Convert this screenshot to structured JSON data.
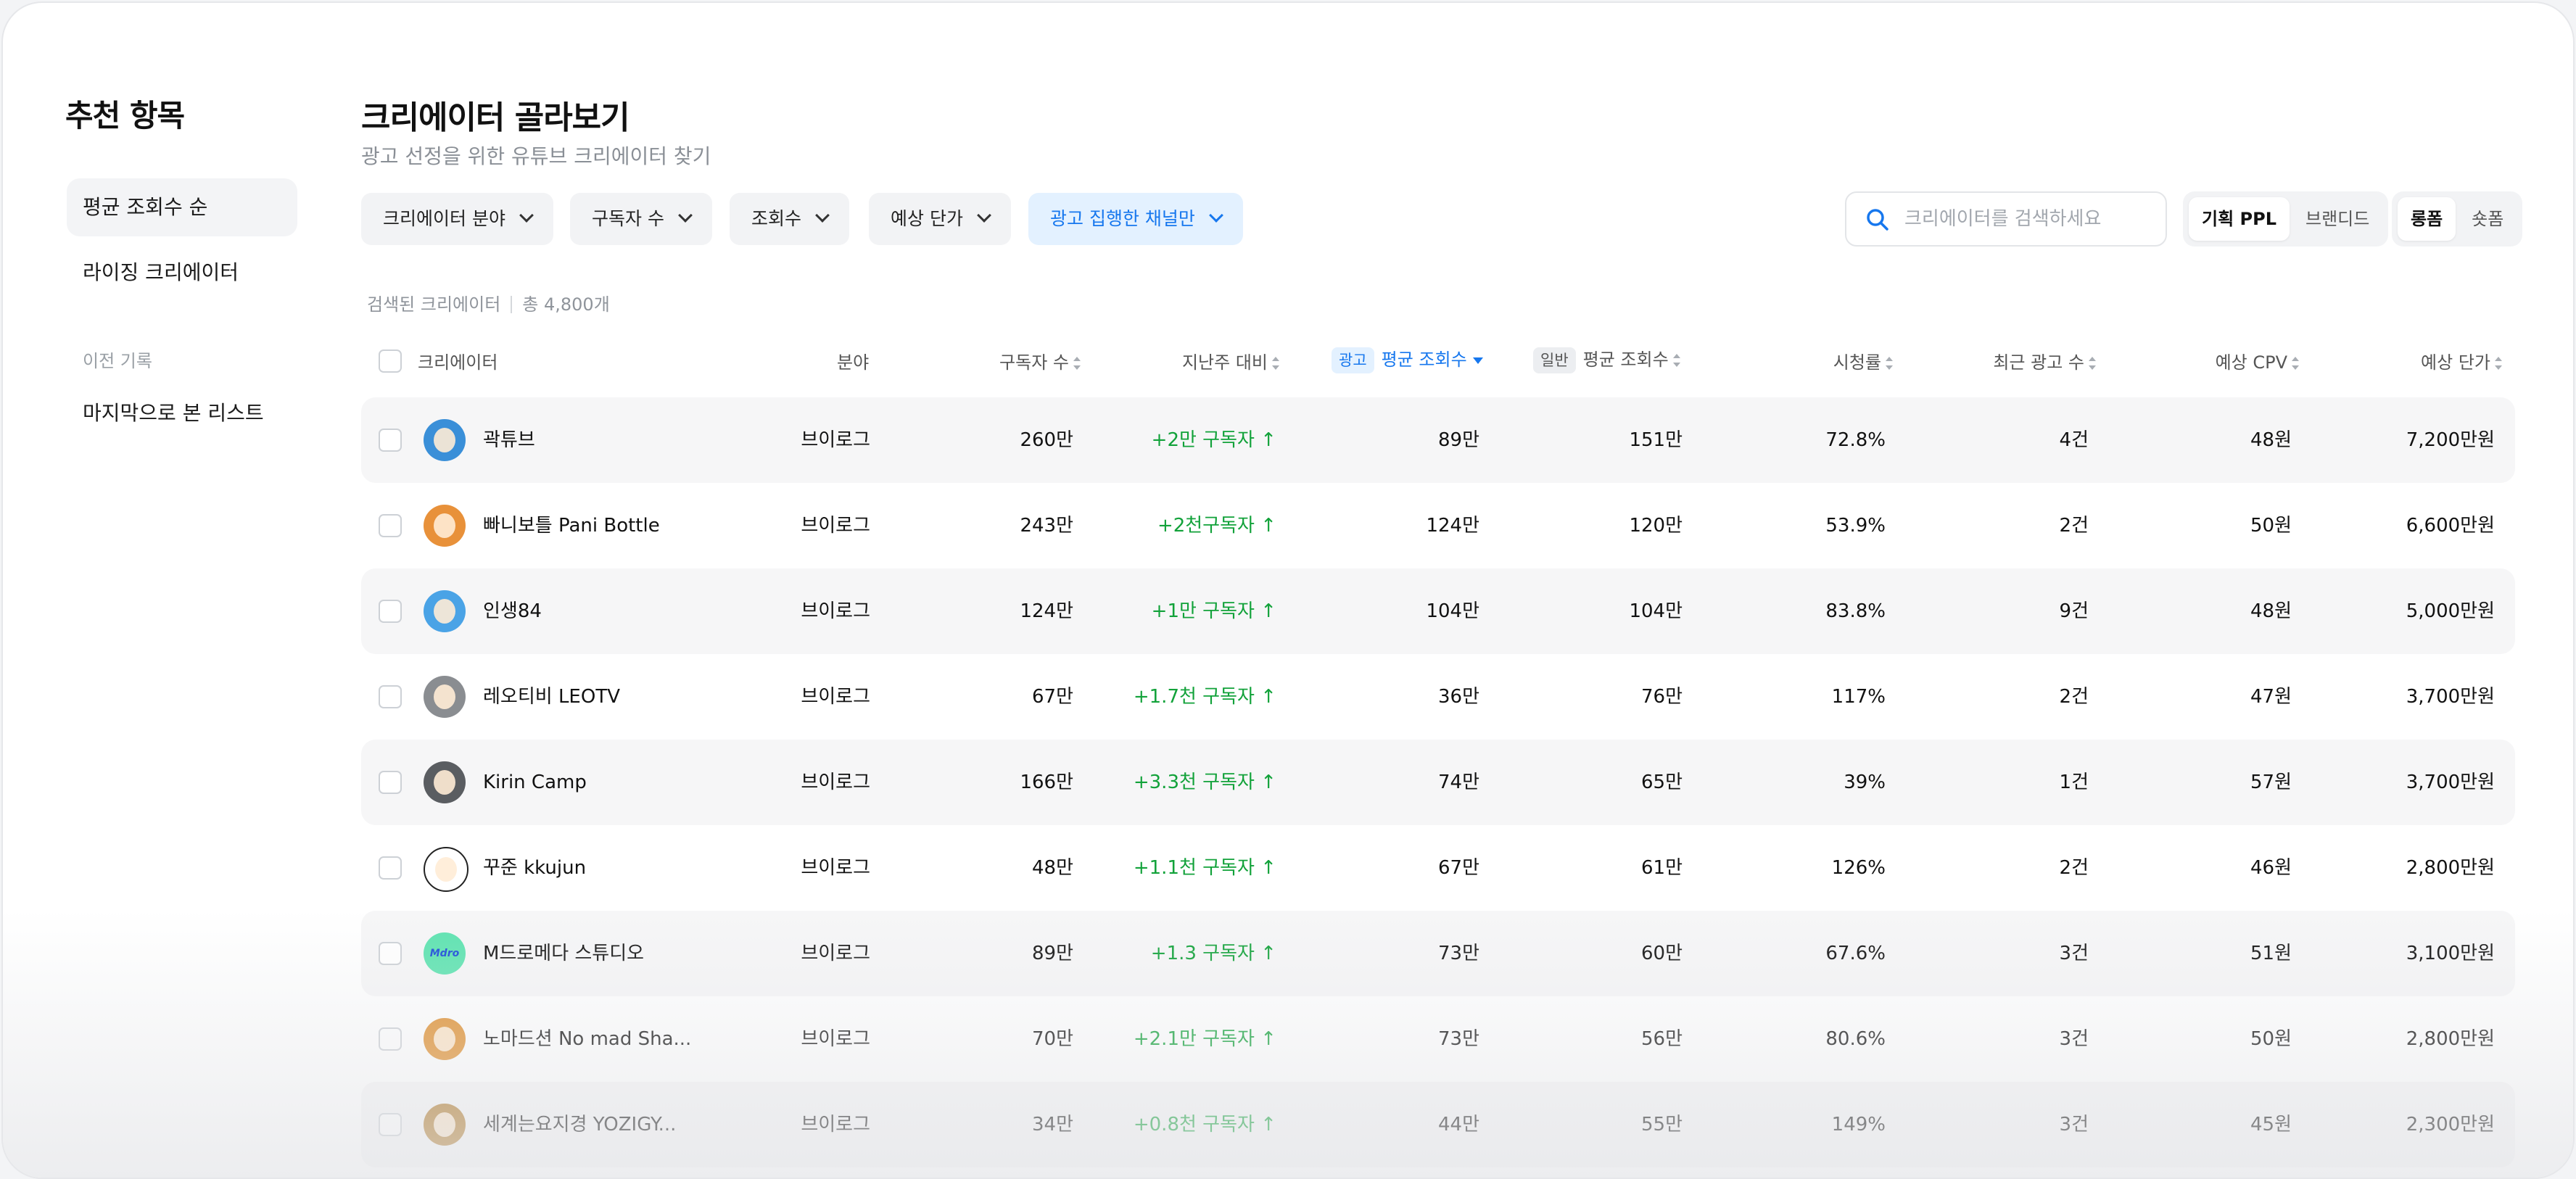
{
  "sidebar": {
    "title": "추천 항목",
    "items": [
      {
        "label": "평균 조회수 순",
        "active": true
      },
      {
        "label": "라이징 크리에이터",
        "active": false
      }
    ],
    "history_label": "이전 기록",
    "history_items": [
      {
        "label": "마지막으로 본 리스트"
      }
    ]
  },
  "header": {
    "title": "크리에이터 골라보기",
    "subtitle": "광고 선정을 위한 유튜브 크리에이터 찾기"
  },
  "filters": [
    {
      "label": "크리에이터 분야",
      "active": false
    },
    {
      "label": "구독자 수",
      "active": false
    },
    {
      "label": "조회수",
      "active": false
    },
    {
      "label": "예상 단가",
      "active": false
    },
    {
      "label": "광고 집행한 채널만",
      "active": true
    }
  ],
  "search": {
    "placeholder": "크리에이터를 검색하세요",
    "icon": "search-icon"
  },
  "segment_type": {
    "options": [
      "기획 PPL",
      "브랜디드"
    ],
    "selected": "기획 PPL"
  },
  "segment_format": {
    "options": [
      "롱폼",
      "숏폼"
    ],
    "selected": "롱폼"
  },
  "result": {
    "label": "검색된 크리에이터",
    "total": "총 4,800개"
  },
  "table": {
    "headers": {
      "creator": "크리에이터",
      "category": "분야",
      "subscribers": "구독자 수",
      "weekly_change": "지난주 대비",
      "ad_tag": "광고",
      "ad_avg_views": "평균 조회수",
      "general_tag": "일반",
      "general_avg_views": "평균 조회수",
      "view_rate": "시청률",
      "recent_ads": "최근 광고 수",
      "cpv": "예상 CPV",
      "price": "예상 단가"
    },
    "sorted_column": "ad_avg_views",
    "rows": [
      {
        "name": "곽튜브",
        "category": "브이로그",
        "subscribers": "260만",
        "change": "+2만 구독자 ↑",
        "ad_views": "89만",
        "general_views": "151만",
        "view_rate": "72.8%",
        "recent_ads": "4건",
        "cpv": "48원",
        "price": "7,200만원",
        "avatar_color": "#3a8fd8"
      },
      {
        "name": "빠니보틀 Pani Bottle",
        "category": "브이로그",
        "subscribers": "243만",
        "change": "+2천구독자 ↑",
        "ad_views": "124만",
        "general_views": "120만",
        "view_rate": "53.9%",
        "recent_ads": "2건",
        "cpv": "50원",
        "price": "6,600만원",
        "avatar_color": "#e8913a"
      },
      {
        "name": "인생84",
        "category": "브이로그",
        "subscribers": "124만",
        "change": "+1만 구독자 ↑",
        "ad_views": "104만",
        "general_views": "104만",
        "view_rate": "83.8%",
        "recent_ads": "9건",
        "cpv": "48원",
        "price": "5,000만원",
        "avatar_color": "#4aa3e6"
      },
      {
        "name": "레오티비 LEOTV",
        "category": "브이로그",
        "subscribers": "67만",
        "change": "+1.7천 구독자 ↑",
        "ad_views": "36만",
        "general_views": "76만",
        "view_rate": "117%",
        "recent_ads": "2건",
        "cpv": "47원",
        "price": "3,700만원",
        "avatar_color": "#8a8d91"
      },
      {
        "name": "Kirin Camp",
        "category": "브이로그",
        "subscribers": "166만",
        "change": "+3.3천 구독자 ↑",
        "ad_views": "74만",
        "general_views": "65만",
        "view_rate": "39%",
        "recent_ads": "1건",
        "cpv": "57원",
        "price": "3,700만원",
        "avatar_color": "#5a5d61"
      },
      {
        "name": "꾸준 kkujun",
        "category": "브이로그",
        "subscribers": "48만",
        "change": "+1.1천 구독자 ↑",
        "ad_views": "67만",
        "general_views": "61만",
        "view_rate": "126%",
        "recent_ads": "2건",
        "cpv": "46원",
        "price": "2,800만원",
        "avatar_color": "#ffffff"
      },
      {
        "name": "M드로메다 스튜디오",
        "category": "브이로그",
        "subscribers": "89만",
        "change": "+1.3 구독자 ↑",
        "ad_views": "73만",
        "general_views": "60만",
        "view_rate": "67.6%",
        "recent_ads": "3건",
        "cpv": "51원",
        "price": "3,100만원",
        "avatar_color": "#5de3b0",
        "avatar_text": "Mdro"
      },
      {
        "name": "노마드션 No mad Sha...",
        "category": "브이로그",
        "subscribers": "70만",
        "change": "+2.1만 구독자 ↑",
        "ad_views": "73만",
        "general_views": "56만",
        "view_rate": "80.6%",
        "recent_ads": "3건",
        "cpv": "50원",
        "price": "2,800만원",
        "avatar_color": "#e0902f"
      },
      {
        "name": "세계는요지경 YOZIGY...",
        "category": "브이로그",
        "subscribers": "34만",
        "change": "+0.8천 구독자 ↑",
        "ad_views": "44만",
        "general_views": "55만",
        "view_rate": "149%",
        "recent_ads": "3건",
        "cpv": "45원",
        "price": "2,300만원",
        "avatar_color": "#b07a2a"
      }
    ]
  }
}
